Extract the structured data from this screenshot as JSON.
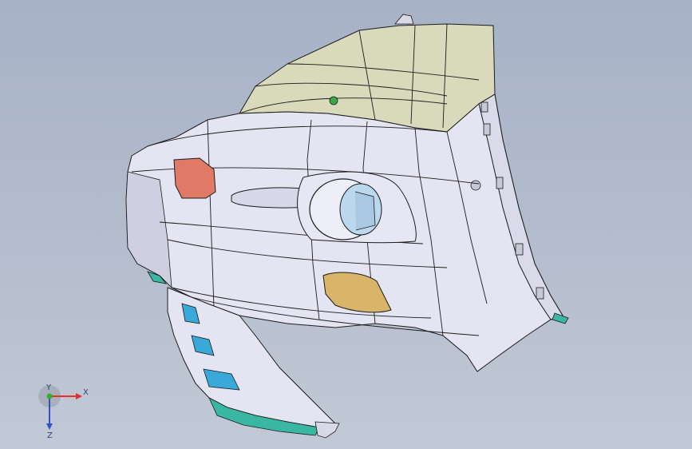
{
  "viewport": {
    "name": "cad-3d-viewport",
    "background_top": "#a7b2c6",
    "background_bottom": "#c2c9d6"
  },
  "model": {
    "name": "rear-bumper-quarter-panel",
    "colors": {
      "body": "#e4e4f2",
      "body_shadow": "#c9c9dd",
      "roof_panel": "#d8d8bc",
      "edge_lines": "#1c1c1c",
      "tail_lamp": "#e07a66",
      "reflector": "#d9b56a",
      "exhaust_inner": "#bcd8ee",
      "lower_trim_blue": "#3aa8d8",
      "lower_trim_teal": "#3ab7a2",
      "datum_marker": "#39a84a"
    }
  },
  "triad": {
    "x_label": "X",
    "y_label": "Y",
    "z_label": "Z",
    "x_color": "#e03030",
    "y_color": "#30b030",
    "z_color": "#3050d0"
  }
}
